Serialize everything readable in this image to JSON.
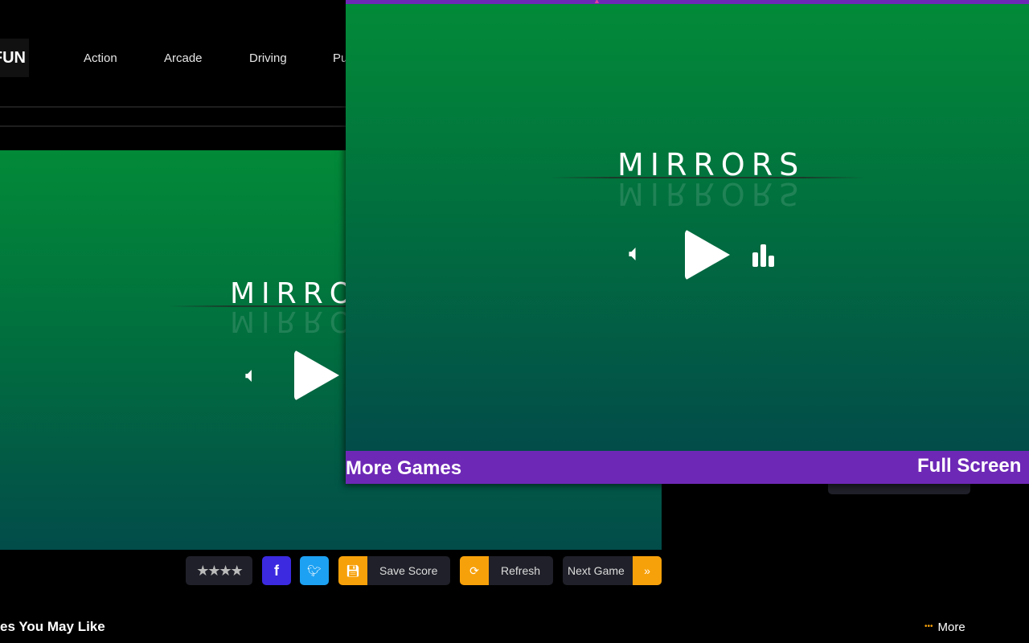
{
  "header": {
    "logo": "FUN",
    "nav": [
      "Action",
      "Arcade",
      "Driving",
      "Pu"
    ]
  },
  "game": {
    "title": "MIRRORS",
    "icons": [
      "sound-icon",
      "play-icon",
      "leaderboard-icon"
    ]
  },
  "overlay": {
    "more_games": "More Games",
    "full_screen": "Full Screen"
  },
  "toolbar": {
    "rating_stars": 4,
    "save_score": "Save Score",
    "refresh": "Refresh",
    "next_game": "Next Game",
    "next_icon": "»"
  },
  "section": {
    "title": "es You May Like",
    "more": "More",
    "more_icon": "•••"
  },
  "colors": {
    "purple": "#6e28b6",
    "orange": "#f7a10a",
    "facebook": "#3b2ae0",
    "twitter": "#1da1f2"
  }
}
